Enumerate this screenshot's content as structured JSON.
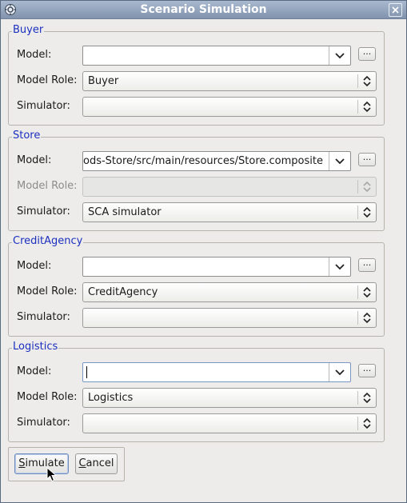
{
  "window": {
    "title": "Scenario Simulation"
  },
  "labels": {
    "model": "Model:",
    "model_role": "Model Role:",
    "simulator": "Simulator:",
    "browse": "..."
  },
  "groups": [
    {
      "title": "Buyer",
      "model": "",
      "model_role": "Buyer",
      "simulator": ""
    },
    {
      "title": "Store",
      "model": "ods-Store/src/main/resources/Store.composite",
      "model_role": "",
      "simulator": "SCA simulator"
    },
    {
      "title": "CreditAgency",
      "model": "",
      "model_role": "CreditAgency",
      "simulator": ""
    },
    {
      "title": "Logistics",
      "model": "",
      "model_role": "Logistics",
      "simulator": ""
    }
  ],
  "buttons": {
    "simulate": {
      "mnemonic": "S",
      "rest": "imulate"
    },
    "cancel": {
      "mnemonic": "C",
      "rest": "ancel"
    }
  },
  "colors": {
    "group_title": "#1c2fbf",
    "titlebar": "#8193ad"
  }
}
